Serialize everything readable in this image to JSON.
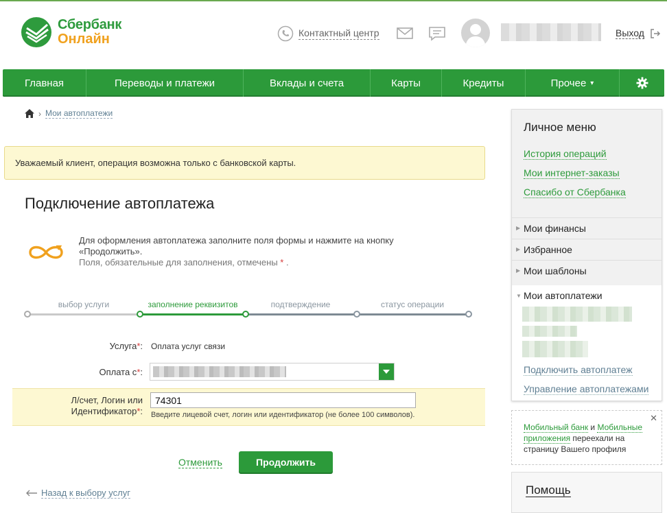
{
  "header": {
    "logo_line1": "Сбербанк",
    "logo_line2": "Онлайн",
    "contact_center": "Контактный центр",
    "logout": "Выход"
  },
  "nav": {
    "items": [
      "Главная",
      "Переводы и платежи",
      "Вклады и счета",
      "Карты",
      "Кредиты",
      "Прочее",
      ""
    ]
  },
  "breadcrumb": {
    "current": "Мои автоплатежи"
  },
  "notice": "Уважаемый клиент, операция возможна только с банковской карты.",
  "page_title": "Подключение автоплатежа",
  "intro": {
    "line1": "Для оформления автоплатежа заполните поля формы и нажмите на кнопку «Продолжить».",
    "line2": "Поля, обязательные для заполнения, отмечены",
    "req_mark": "*",
    "period": "."
  },
  "steps": [
    "выбор услуги",
    "заполнение реквизитов",
    "подтверждение",
    "статус операции"
  ],
  "form": {
    "service_label": "Услуга",
    "service_value": "Оплата услуг связи",
    "payfrom_label": "Оплата с",
    "account_label_1": "Л/счет, Логин или",
    "account_label_2": "Идентификатор",
    "account_value": "74301",
    "account_hint": "Введите лицевой счет, логин или идентификатор (не более 100 символов).",
    "req_mark": "*",
    "colon": ":"
  },
  "actions": {
    "cancel": "Отменить",
    "continue": "Продолжить",
    "back": "Назад к выбору услуг"
  },
  "sidebar": {
    "title": "Личное меню",
    "links": [
      "История операций",
      "Мои интернет-заказы",
      "Спасибо от Сбербанка"
    ],
    "sections": [
      "Мои финансы",
      "Избранное",
      "Мои шаблоны",
      "Мои автоплатежи"
    ],
    "autopay_links": [
      "Подключить автоплатеж",
      "Управление автоплатежами"
    ]
  },
  "promo": {
    "link1": "Мобильный банк",
    "and": " и ",
    "link2": "Мобильные приложения",
    "rest": " переехали на страницу Вашего профиля",
    "close": "✕"
  },
  "help": {
    "title": "Помощь"
  },
  "colors": {
    "green": "#2c9a3a",
    "orange": "#f0a11e",
    "notice_bg": "#fdf8d2",
    "link_gray": "#5f7f93"
  }
}
